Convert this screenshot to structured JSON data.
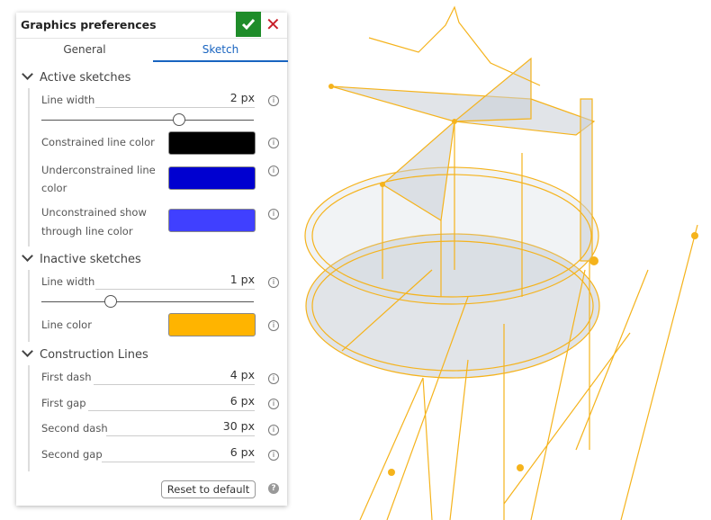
{
  "dialog": {
    "title": "Graphics preferences",
    "confirm_icon": "check-icon",
    "cancel_icon": "close-icon",
    "ok_color": "#1f8c2a",
    "cancel_color": "#c8202a"
  },
  "tabs": [
    {
      "label": "General",
      "active": false
    },
    {
      "label": "Sketch",
      "active": true
    }
  ],
  "sections": {
    "active": {
      "title": "Active sketches",
      "line_width_label": "Line width",
      "line_width": "2 px",
      "line_width_slider": 0.65,
      "constrained_label": "Constrained line color",
      "constrained_color": "#000000",
      "underconstrained_label_1": "Underconstrained line",
      "underconstrained_label_2": "color",
      "underconstrained_color": "#0000d0",
      "unconstrained_label_1": "Unconstrained show",
      "unconstrained_label_2": "through line color",
      "unconstrained_color": "#4040ff"
    },
    "inactive": {
      "title": "Inactive sketches",
      "line_width_label": "Line width",
      "line_width": "1 px",
      "line_width_slider": 0.32,
      "line_color_label": "Line color",
      "line_color": "#ffb400"
    },
    "construction": {
      "title": "Construction Lines",
      "first_dash_label": "First dash",
      "first_dash": "4 px",
      "first_gap_label": "First gap",
      "first_gap": "6 px",
      "second_dash_label": "Second dash",
      "second_dash": "30 px",
      "second_gap_label": "Second gap",
      "second_gap": "6 px"
    }
  },
  "footer": {
    "reset_label": "Reset to default",
    "help_icon": "question-icon"
  },
  "viewport": {
    "sketch_color": "#f5b31c",
    "surface_color": "#c9ced6"
  }
}
